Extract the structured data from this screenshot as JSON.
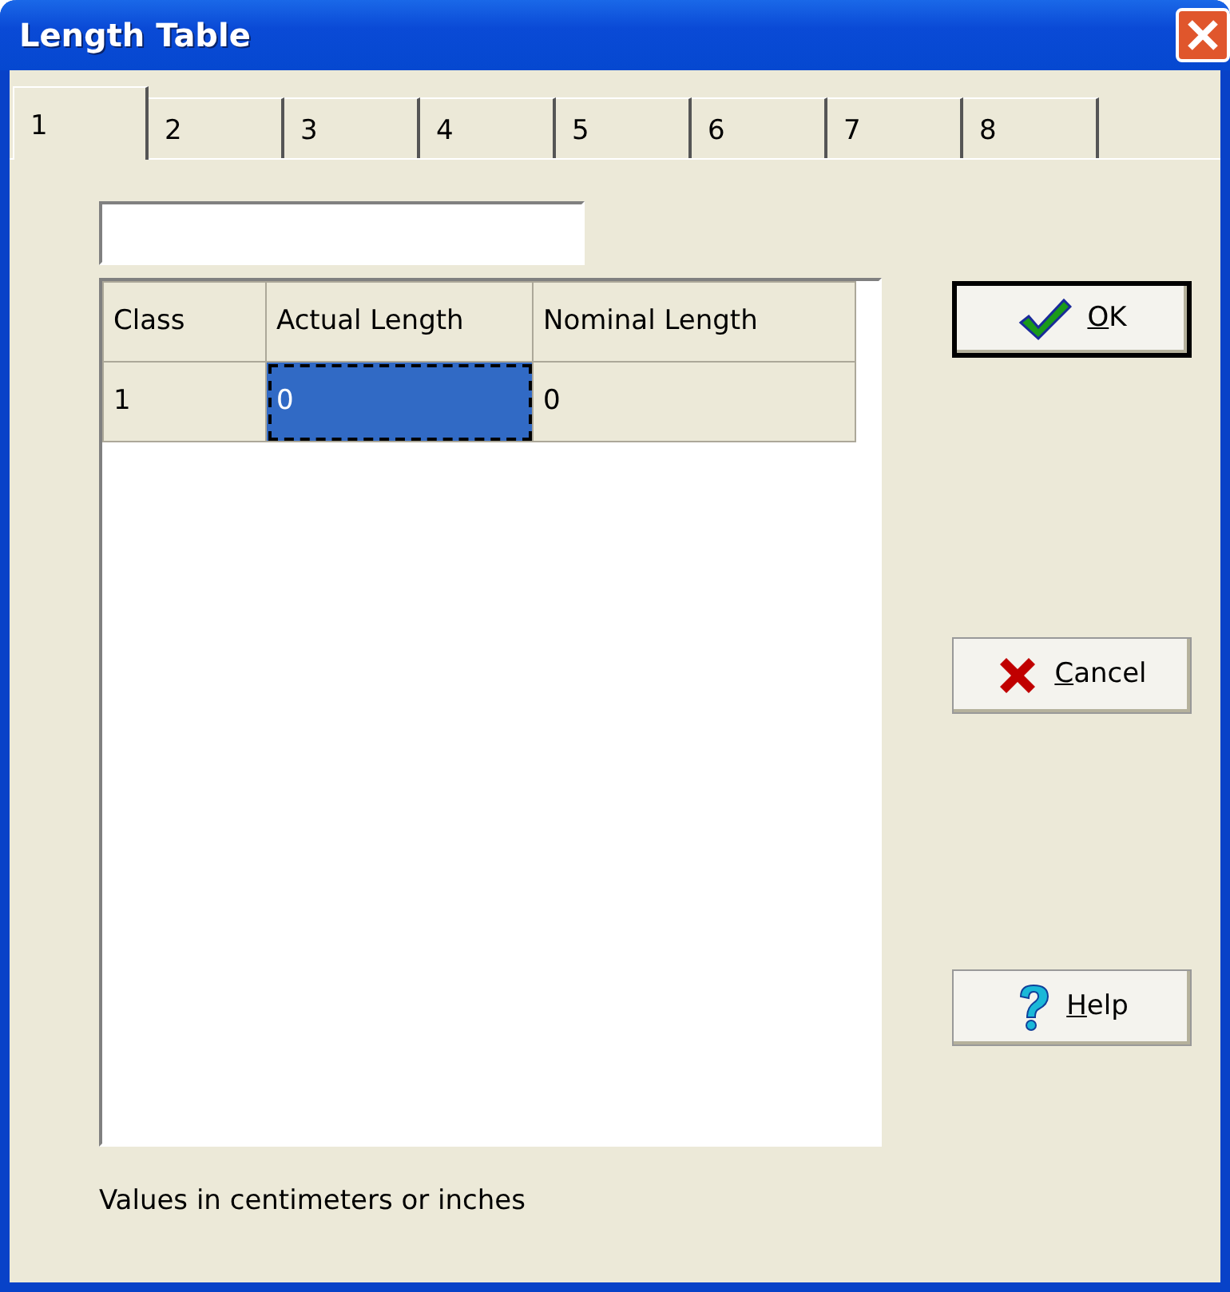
{
  "window": {
    "title": "Length Table"
  },
  "tabs": [
    {
      "label": "1",
      "selected": true
    },
    {
      "label": "2",
      "selected": false
    },
    {
      "label": "3",
      "selected": false
    },
    {
      "label": "4",
      "selected": false
    },
    {
      "label": "5",
      "selected": false
    },
    {
      "label": "6",
      "selected": false
    },
    {
      "label": "7",
      "selected": false
    },
    {
      "label": "8",
      "selected": false
    }
  ],
  "table": {
    "columns": [
      "Class",
      "Actual Length",
      "Nominal Length"
    ],
    "rows": [
      {
        "cells": [
          {
            "text": "1",
            "selected": false
          },
          {
            "text": "0",
            "selected": true
          },
          {
            "text": "0",
            "selected": false
          }
        ]
      }
    ]
  },
  "buttons": [
    {
      "kind": "ok",
      "label": "OK",
      "underline_first": true,
      "default": true
    },
    {
      "kind": "cancel",
      "label": "Cancel",
      "underline_first": true,
      "default": false
    },
    {
      "kind": "help",
      "label": "Help",
      "underline_first": true,
      "default": false
    }
  ],
  "footer": "Values in centimeters or inches"
}
